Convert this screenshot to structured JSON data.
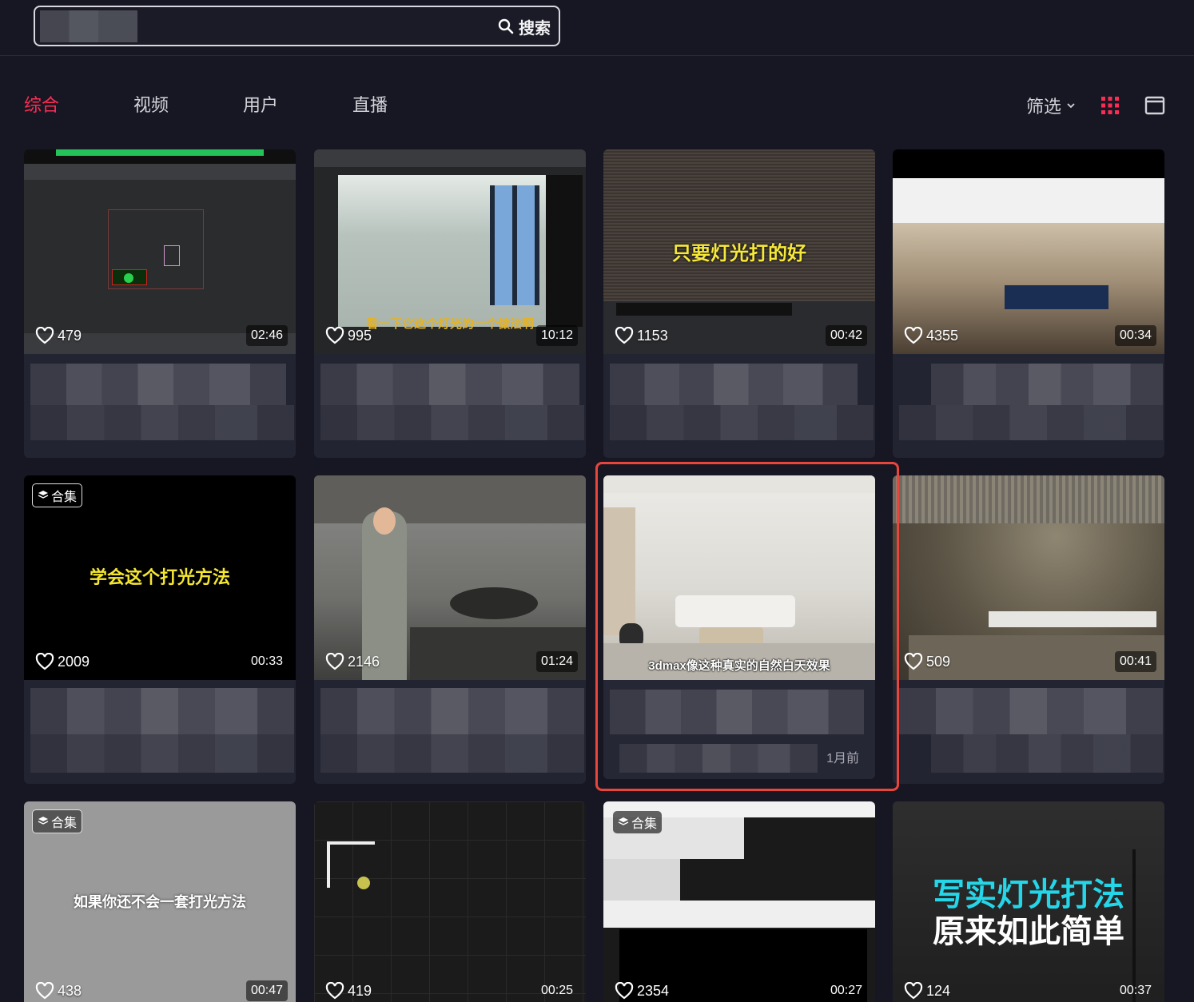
{
  "search": {
    "button_label": "搜索"
  },
  "tabs": [
    {
      "label": "综合",
      "active": true
    },
    {
      "label": "视频",
      "active": false
    },
    {
      "label": "用户",
      "active": false
    },
    {
      "label": "直播",
      "active": false
    }
  ],
  "toolbar": {
    "filter_label": "筛选",
    "grid_icon": "grid-icon",
    "list_icon": "single-column-icon"
  },
  "colors": {
    "accent": "#fe2c55",
    "highlight": "#e8453c",
    "bg": "#161722",
    "card": "#232431"
  },
  "rows": [
    [
      {
        "likes": "479",
        "duration": "02:46",
        "overlay": "",
        "collection": ""
      },
      {
        "likes": "995",
        "duration": "10:12",
        "overlay": "看一下它这个灯光的一个做法啊",
        "collection": ""
      },
      {
        "likes": "1153",
        "duration": "00:42",
        "overlay": "只要灯光打的好",
        "collection": ""
      },
      {
        "likes": "4355",
        "duration": "00:34",
        "overlay": "",
        "collection": ""
      }
    ],
    [
      {
        "likes": "2009",
        "duration": "00:33",
        "overlay": "学会这个打光方法",
        "collection": "合集"
      },
      {
        "likes": "2146",
        "duration": "01:24",
        "overlay": "",
        "collection": ""
      },
      {
        "likes": "",
        "duration": "",
        "overlay": "3dmax像这种真实的自然白天效果",
        "collection": "",
        "time_ago": "1月前"
      },
      {
        "likes": "509",
        "duration": "00:41",
        "overlay": "",
        "collection": ""
      }
    ],
    [
      {
        "likes": "438",
        "duration": "00:47",
        "overlay": "如果你还不会一套打光方法",
        "collection": "合集"
      },
      {
        "likes": "419",
        "duration": "00:25",
        "overlay": "",
        "collection": ""
      },
      {
        "likes": "2354",
        "duration": "00:27",
        "overlay": "",
        "collection": "合集"
      },
      {
        "likes": "124",
        "duration": "00:37",
        "overlay_line1": "写实灯光打法",
        "overlay_line2": "原来如此简单",
        "collection": ""
      }
    ]
  ]
}
